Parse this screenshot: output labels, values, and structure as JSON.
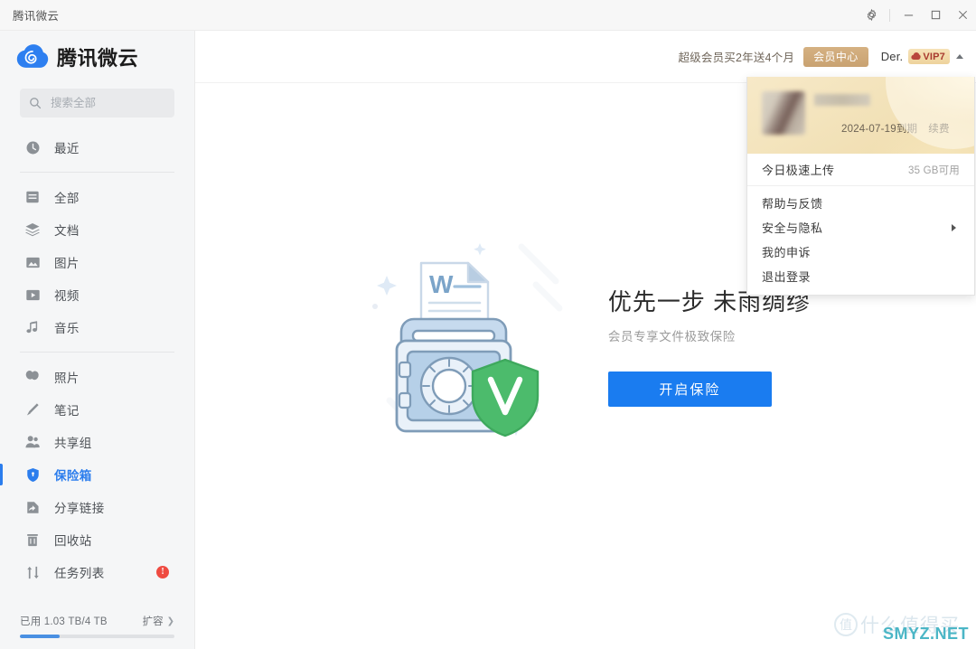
{
  "window": {
    "app_title": "腾讯微云",
    "controls": {
      "settings": "settings-gear",
      "minimize": "最小化",
      "maximize": "最大化",
      "close": "关闭"
    }
  },
  "sidebar": {
    "brand": "腾讯微云",
    "search": {
      "placeholder": "搜索全部",
      "value": ""
    },
    "groups": [
      {
        "items": [
          {
            "label": "最近",
            "icon": "clock-icon",
            "active": false
          }
        ]
      },
      {
        "items": [
          {
            "label": "全部",
            "icon": "all-files-icon",
            "active": false
          },
          {
            "label": "文档",
            "icon": "document-stack-icon",
            "active": false
          },
          {
            "label": "图片",
            "icon": "image-icon",
            "active": false
          },
          {
            "label": "视频",
            "icon": "video-icon",
            "active": false
          },
          {
            "label": "音乐",
            "icon": "music-note-icon",
            "active": false
          }
        ]
      },
      {
        "items": [
          {
            "label": "照片",
            "icon": "photos-icon",
            "active": false
          },
          {
            "label": "笔记",
            "icon": "pen-icon",
            "active": false
          },
          {
            "label": "共享组",
            "icon": "group-icon",
            "active": false
          },
          {
            "label": "保险箱",
            "icon": "shield-icon",
            "active": true
          },
          {
            "label": "分享链接",
            "icon": "share-link-icon",
            "active": false
          },
          {
            "label": "回收站",
            "icon": "trash-icon",
            "active": false
          },
          {
            "label": "任务列表",
            "icon": "transfer-icon",
            "active": false,
            "badge": "!"
          }
        ]
      }
    ],
    "storage": {
      "used_text": "已用 1.03 TB/4 TB",
      "expand_label": "扩容",
      "expand_chevron": "chevron-right-icon",
      "percent": 26
    }
  },
  "topbar": {
    "promo_text": "超级会员买2年送4个月",
    "vip_center_label": "会员中心",
    "user_name": "Der.",
    "vip_badge": "VIP7",
    "vip_badge_icon": "cloud-icon",
    "caret": "caret-up-icon"
  },
  "dropdown": {
    "expiry": "2024-07-19到期",
    "renew_label": "续费",
    "upload": {
      "label": "今日极速上传",
      "quota": "35 GB可用"
    },
    "items": [
      {
        "label": "帮助与反馈",
        "submenu": false
      },
      {
        "label": "安全与隐私",
        "submenu": true
      },
      {
        "label": "我的申诉",
        "submenu": false
      },
      {
        "label": "退出登录",
        "submenu": false
      }
    ]
  },
  "content": {
    "headline": "优先一步 未雨绸缪",
    "subline": "会员专享文件极致保险",
    "cta_label": "开启保险",
    "illustration": {
      "name": "safe-vault-with-document-and-shield",
      "doc_letter": "W",
      "shield_letter": "V"
    }
  },
  "watermark": {
    "mark_char": "值",
    "brand_text": "什么值得买",
    "site": "SMYZ.NET"
  },
  "colors": {
    "accent_blue": "#1a7cf0",
    "sidebar_bg": "#f5f6f7",
    "vip_gold": "#c9a271",
    "badge_red": "#ef4b41",
    "shield_green": "#4cbb6c"
  }
}
